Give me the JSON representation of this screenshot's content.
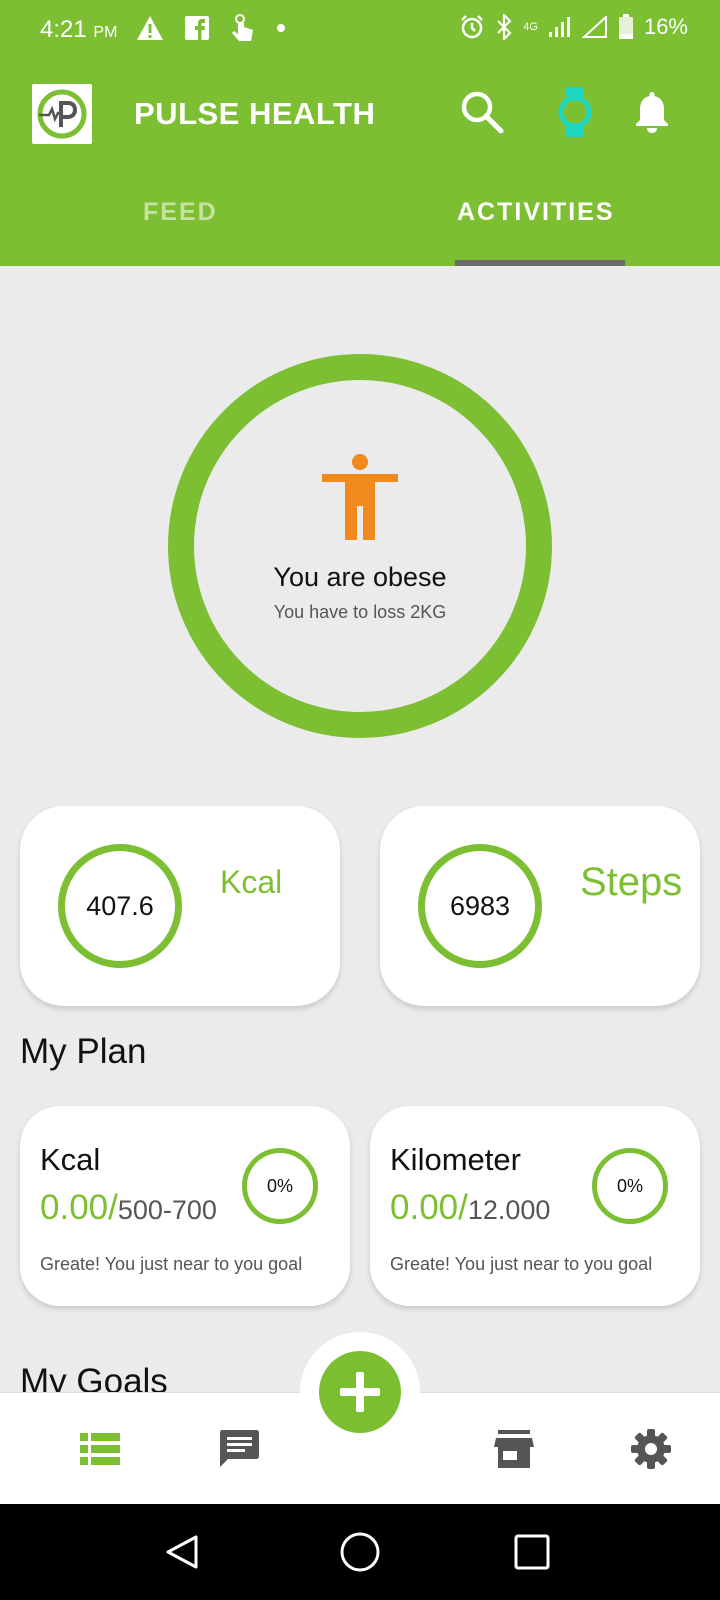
{
  "status_bar": {
    "time": "4:21",
    "ampm": "PM",
    "network": "4G",
    "battery": "16%"
  },
  "app": {
    "title": "PULSE HEALTH",
    "logo_letter": "P"
  },
  "tabs": [
    {
      "label": "FEED",
      "active": false
    },
    {
      "label": "ACTIVITIES",
      "active": true
    }
  ],
  "body_status": {
    "title": "You are obese",
    "subtitle": "You have to loss 2KG"
  },
  "stats": [
    {
      "value": "407.6",
      "label": "Kcal"
    },
    {
      "value": "6983",
      "label": "Steps"
    }
  ],
  "plan": {
    "title": "My Plan",
    "items": [
      {
        "title": "Kcal",
        "current": "0.00/",
        "target": "500-700",
        "percent": "0%",
        "message": "Greate! You just near to you goal"
      },
      {
        "title": "Kilometer",
        "current": "0.00/",
        "target": "12.000",
        "percent": "0%",
        "message": "Greate! You just near to you goal"
      }
    ]
  },
  "goals": {
    "title": "My Goals"
  },
  "colors": {
    "accent": "#7cbf33",
    "orange": "#f08a1c",
    "watch": "#1fd6c0"
  }
}
